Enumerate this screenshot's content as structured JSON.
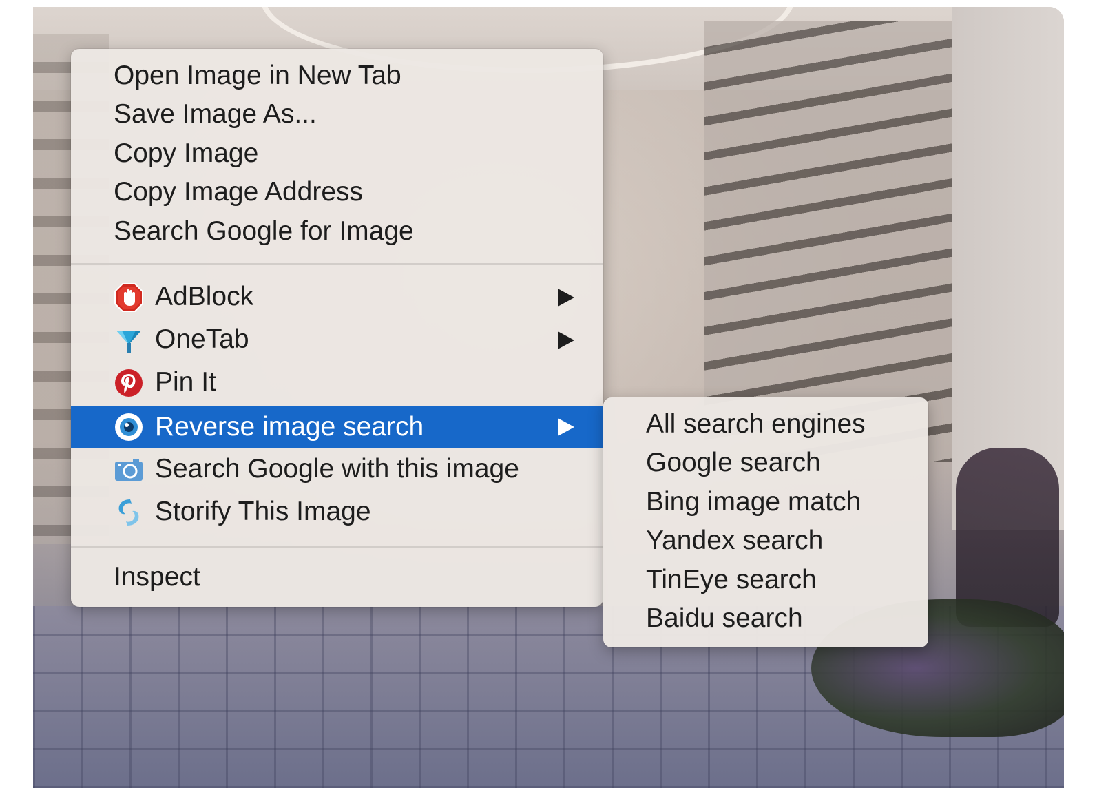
{
  "context_menu": {
    "items": [
      {
        "label": "Open Image in New Tab"
      },
      {
        "label": "Save Image As..."
      },
      {
        "label": "Copy Image"
      },
      {
        "label": "Copy Image Address"
      },
      {
        "label": "Search Google for Image"
      }
    ],
    "extensions": [
      {
        "label": "AdBlock",
        "icon": "adblock-icon",
        "has_submenu": true
      },
      {
        "label": "OneTab",
        "icon": "onetab-icon",
        "has_submenu": true
      },
      {
        "label": "Pin It",
        "icon": "pinterest-icon",
        "has_submenu": false
      },
      {
        "label": "Reverse image search",
        "icon": "reverse-image-search-icon",
        "has_submenu": true,
        "highlighted": true
      },
      {
        "label": "Search Google with this image",
        "icon": "camera-icon",
        "has_submenu": false
      },
      {
        "label": "Storify This Image",
        "icon": "storify-icon",
        "has_submenu": false
      }
    ],
    "inspect": {
      "label": "Inspect"
    }
  },
  "submenu": {
    "items": [
      {
        "label": "All search engines"
      },
      {
        "label": "Google search"
      },
      {
        "label": "Bing image match"
      },
      {
        "label": "Yandex search"
      },
      {
        "label": "TinEye search"
      },
      {
        "label": "Baidu search"
      }
    ]
  },
  "colors": {
    "highlight": "#1768c9",
    "menu_background": "#ece7e3",
    "adblock_red": "#d0291f",
    "pinterest_red": "#cb2027",
    "onetab_blue": "#2aa6d9",
    "camera_blue": "#5b9bd5",
    "storify_blue": "#3b9fd8"
  }
}
